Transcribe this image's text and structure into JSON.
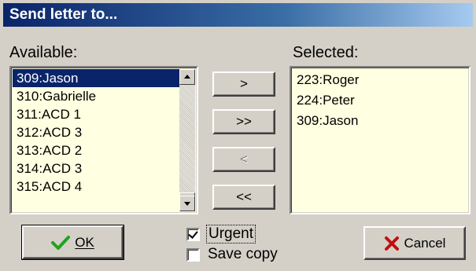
{
  "dialog": {
    "title": "Send letter to..."
  },
  "available": {
    "label": "Available:",
    "items": [
      "309:Jason",
      "310:Gabrielle",
      "311:ACD 1",
      "312:ACD 3",
      "313:ACD 2",
      "314:ACD 3",
      "315:ACD 4"
    ],
    "selected_item": "309:Jason"
  },
  "selected": {
    "label": "Selected:",
    "items": [
      "223:Roger",
      "224:Peter",
      "309:Jason"
    ]
  },
  "transfer_buttons": {
    "add": ">",
    "add_all": ">>",
    "remove": "<",
    "remove_all": "<<"
  },
  "options": {
    "urgent": {
      "label": "Urgent",
      "checked": true
    },
    "save_copy": {
      "label": "Save copy",
      "checked": false
    }
  },
  "actions": {
    "ok": "OK",
    "cancel": "Cancel"
  },
  "colors": {
    "titlebar_start": "#0a246a",
    "titlebar_end": "#a6caf0",
    "list_bg": "#ffffe1",
    "selection": "#0a246a",
    "ok_icon": "#1fa31f",
    "cancel_icon": "#c01010"
  },
  "icons": {
    "ok": "check-icon",
    "cancel": "x-icon"
  }
}
